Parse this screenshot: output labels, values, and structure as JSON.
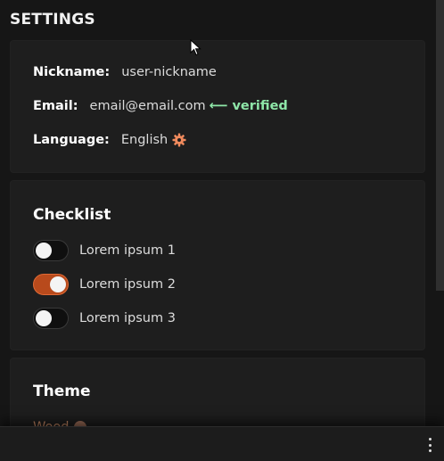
{
  "page": {
    "title": "SETTINGS"
  },
  "profile": {
    "nickname": {
      "label": "Nickname:",
      "value": "user-nickname"
    },
    "email": {
      "label": "Email:",
      "value": "email@email.com",
      "status": "⟵ verified"
    },
    "language": {
      "label": "Language:",
      "value": "English",
      "icon": "gear-icon"
    }
  },
  "checklist": {
    "title": "Checklist",
    "items": [
      {
        "label": "Lorem ipsum 1",
        "checked": false
      },
      {
        "label": "Lorem ipsum 2",
        "checked": true
      },
      {
        "label": "Lorem ipsum 3",
        "checked": false
      }
    ]
  },
  "theme": {
    "title": "Theme",
    "value": "Wood",
    "icon": "info-icon"
  },
  "colors": {
    "accent": "#b84a1c",
    "verified": "#8ee6a8",
    "background": "#161616",
    "card": "#1e1e1e"
  },
  "bottom_bar": {
    "menu_icon": "more-vertical-icon"
  }
}
